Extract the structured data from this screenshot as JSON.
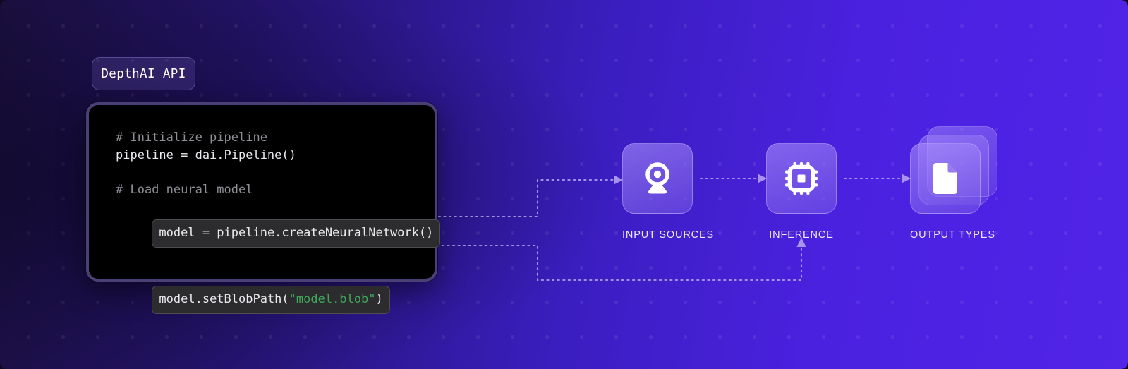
{
  "badge": {
    "label": "DepthAI API"
  },
  "code": {
    "lines": [
      {
        "kind": "comment",
        "text": "# Initialize pipeline"
      },
      {
        "kind": "plain",
        "text": "pipeline = dai.Pipeline()"
      },
      {
        "kind": "spacer",
        "text": ""
      },
      {
        "kind": "comment",
        "text": "# Load neural model"
      }
    ],
    "highlight_1": "model = pipeline.createNeuralNetwork()",
    "highlight_2_prefix": "model.setBlobPath(",
    "highlight_2_string": "\"model.blob\"",
    "highlight_2_suffix": ")"
  },
  "nodes": [
    {
      "id": "input-sources",
      "label": "INPUT SOURCES",
      "icon": "webcam-icon"
    },
    {
      "id": "inference",
      "label": "INFERENCE",
      "icon": "chip-icon"
    },
    {
      "id": "output-types",
      "label": "OUTPUT TYPES",
      "icon": "document-icon"
    }
  ],
  "colors": {
    "accent_purple": "#5124e8",
    "deep_purple": "#1a0f3d",
    "tile_fill": "#7c5ee8",
    "code_background": "#000000",
    "highlight_background": "#2c2c2e",
    "string_green": "#3fa85a",
    "connector": "#b9a8f0"
  },
  "connectors": {
    "from_create_network": "dotted path from createNeuralNetwork line to INPUT SOURCES",
    "from_blob_path": "dotted path from setBlobPath line to INFERENCE",
    "input_to_inference": "dotted arrow",
    "inference_to_output": "dotted arrow"
  }
}
